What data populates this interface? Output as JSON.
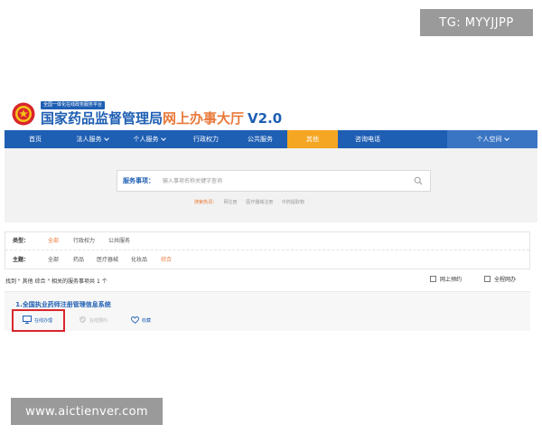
{
  "watermarks": {
    "top": "TG: MYYJJPP",
    "bottom": "www.aictienver.com"
  },
  "header": {
    "badge": "全国一体化在线政务服务平台",
    "title_part1": "国家药品监督管理局",
    "title_part2": "网上办事大厅",
    "version": "V2.0",
    "emblem_icon": "national-emblem-icon"
  },
  "nav": {
    "items": [
      {
        "label": "首页"
      },
      {
        "label": "法人服务"
      },
      {
        "label": "个人服务"
      },
      {
        "label": "行政权力"
      },
      {
        "label": "公共服务"
      },
      {
        "label": "其他"
      },
      {
        "label": "咨询电话"
      }
    ],
    "user": "个人空间",
    "active_index": 5
  },
  "search": {
    "label": "服务事项：",
    "placeholder": "输入事项名称关键字查询",
    "hot_label": "搜索热词：",
    "hot_words": [
      "网注册",
      "医疗器械注册",
      "中药提取物"
    ]
  },
  "filter": {
    "type_label": "类型：",
    "type_options": [
      "全部",
      "行政权力",
      "公共服务"
    ],
    "type_selected": 0,
    "topic_label": "主题：",
    "topic_options": [
      "全部",
      "药品",
      "医疗器械",
      "化妆品",
      "综合"
    ],
    "topic_selected": 4
  },
  "results": {
    "summary": "找到 \" 其他 综合 \" 相关的服务事项共 1 个",
    "checkbox_online": "网上预约",
    "checkbox_all": "全程网办",
    "items": [
      {
        "title": "1.全国执业药师注册管理信息系统",
        "action_online": "在线办理",
        "action_appointment": "在线预约",
        "action_favorite": "收藏"
      }
    ]
  },
  "colors": {
    "brand_blue": "#1f5fb3",
    "accent_orange": "#e8793a",
    "nav_active": "#f5a623",
    "highlight_red": "#d9262b"
  }
}
